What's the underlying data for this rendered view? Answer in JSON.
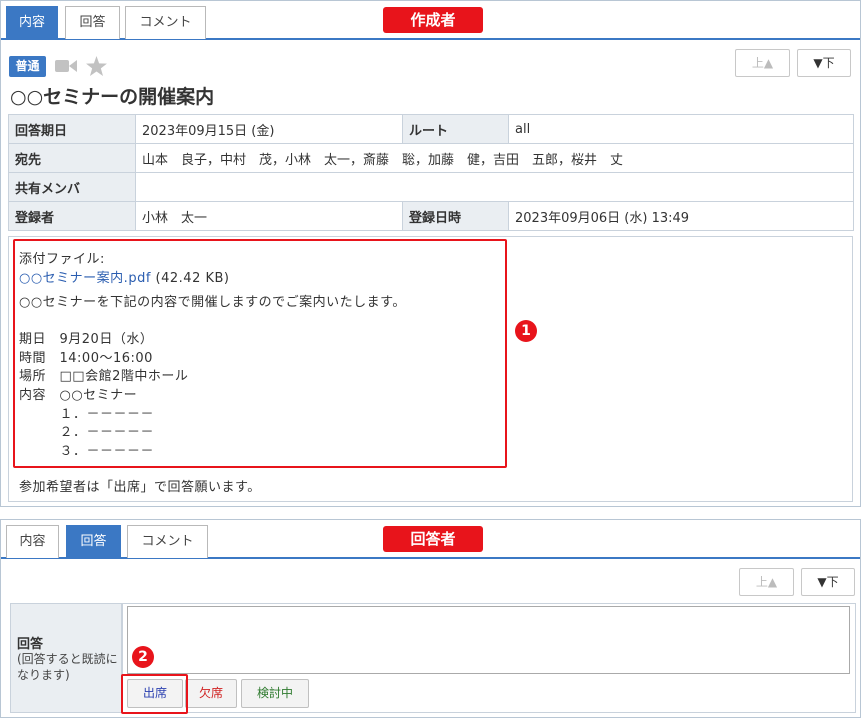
{
  "creator_panel": {
    "tabs": [
      {
        "label": "内容",
        "active": true
      },
      {
        "label": "回答",
        "active": false
      },
      {
        "label": "コメント",
        "active": false
      }
    ],
    "role_label": "作成者",
    "nav": {
      "up": "上▲",
      "down": "▼下"
    },
    "priority": "普通",
    "icons": [
      "video-camera-icon",
      "star-icon"
    ],
    "title": "○○セミナーの開催案内",
    "info_rows": [
      {
        "label": "回答期日",
        "value": "2023年09月15日 (金)",
        "label2": "ルート",
        "value2": "all"
      },
      {
        "label": "宛先",
        "value": "山本　良子，中村　茂，小林　太一，斎藤　聡，加藤　健，吉田　五郎，桜井　丈"
      },
      {
        "label": "共有メンバ",
        "value": ""
      },
      {
        "label": "登録者",
        "value": "小林　太一",
        "label2": "登録日時",
        "value2": "2023年09月06日 (水) 13:49"
      }
    ],
    "attachment_label": "添付ファイル:",
    "attachment_name": "○○セミナー案内.pdf",
    "attachment_size": "(42.42 KB)",
    "body_lines": [
      "○○セミナーを下記の内容で開催しますのでご案内いたします。",
      "",
      "期日　9月20日（水）",
      "時間　14:00～16:00",
      "場所　□□会館2階中ホール",
      "内容　○○セミナー",
      "　　　１．－－－－－",
      "　　　２．－－－－－",
      "　　　３．－－－－－"
    ],
    "footer_line": "参加希望者は「出席」で回答願います。",
    "marker": "1"
  },
  "answerer_panel": {
    "tabs": [
      {
        "label": "内容",
        "active": false
      },
      {
        "label": "回答",
        "active": true
      },
      {
        "label": "コメント",
        "active": false
      }
    ],
    "role_label": "回答者",
    "nav": {
      "up": "上▲",
      "down": "▼下"
    },
    "answer_label": "回答",
    "answer_note": "(回答すると既読になります)",
    "answer_value": "",
    "choices": [
      {
        "label": "出席",
        "color": "#2a3fb0"
      },
      {
        "label": "欠席",
        "color": "#d02020"
      },
      {
        "label": "検討中",
        "color": "#2e7a2e"
      }
    ],
    "marker": "2"
  },
  "colors": {
    "accent": "#3b78c4",
    "highlight": "#e8141b",
    "label_bg": "#eaeef2"
  }
}
